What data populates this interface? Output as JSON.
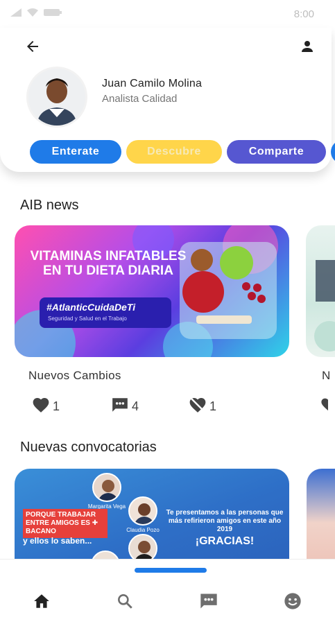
{
  "status_bar": {
    "time": "8:00",
    "icons": [
      "signal-icon",
      "wifi-icon",
      "battery-icon"
    ]
  },
  "header": {
    "back_icon": "back-arrow-icon",
    "profile_icon": "person-icon",
    "user": {
      "name": "Juan Camilo Molina",
      "role": "Analista Calidad"
    },
    "chips": [
      {
        "label": "Enterate",
        "color": "#1f7be8"
      },
      {
        "label": "Descubre",
        "color": "#ffd54a"
      },
      {
        "label": "Comparte",
        "color": "#5657d1"
      }
    ]
  },
  "news": {
    "section_title": "AIB news",
    "card": {
      "banner_title": "VITAMINAS INFATABLES EN TU DIETA DIARIA",
      "banner_hashtag": "#AtlanticCuidaDeTi",
      "banner_subtitle": "Seguridad y Salud en el Trabajo",
      "caption": "Nuevos Cambios",
      "likes": "1",
      "comments": "4",
      "dislikes": "1"
    },
    "partial_caption": "N"
  },
  "convocatorias": {
    "section_title": "Nuevas convocatorias",
    "card": {
      "promo_red": "PORQUE TRABAJAR ENTRE AMIGOS ES ✚ BACANO",
      "promo_white": "y ellos lo saben...",
      "people": [
        "Margarita Vega",
        "Claudia Pozo"
      ],
      "message": "Te presentamos a las personas que más refirieron amigos en este año 2019",
      "thanks": "¡GRACIAS!"
    }
  },
  "bottom_nav": {
    "items": [
      {
        "icon": "home-icon",
        "active": true
      },
      {
        "icon": "search-icon",
        "active": false
      },
      {
        "icon": "chat-icon",
        "active": false
      },
      {
        "icon": "smiley-icon",
        "active": false
      }
    ]
  },
  "colors": {
    "accent_blue": "#1f7be8",
    "accent_yellow": "#ffd54a",
    "accent_purple": "#5657d1"
  }
}
